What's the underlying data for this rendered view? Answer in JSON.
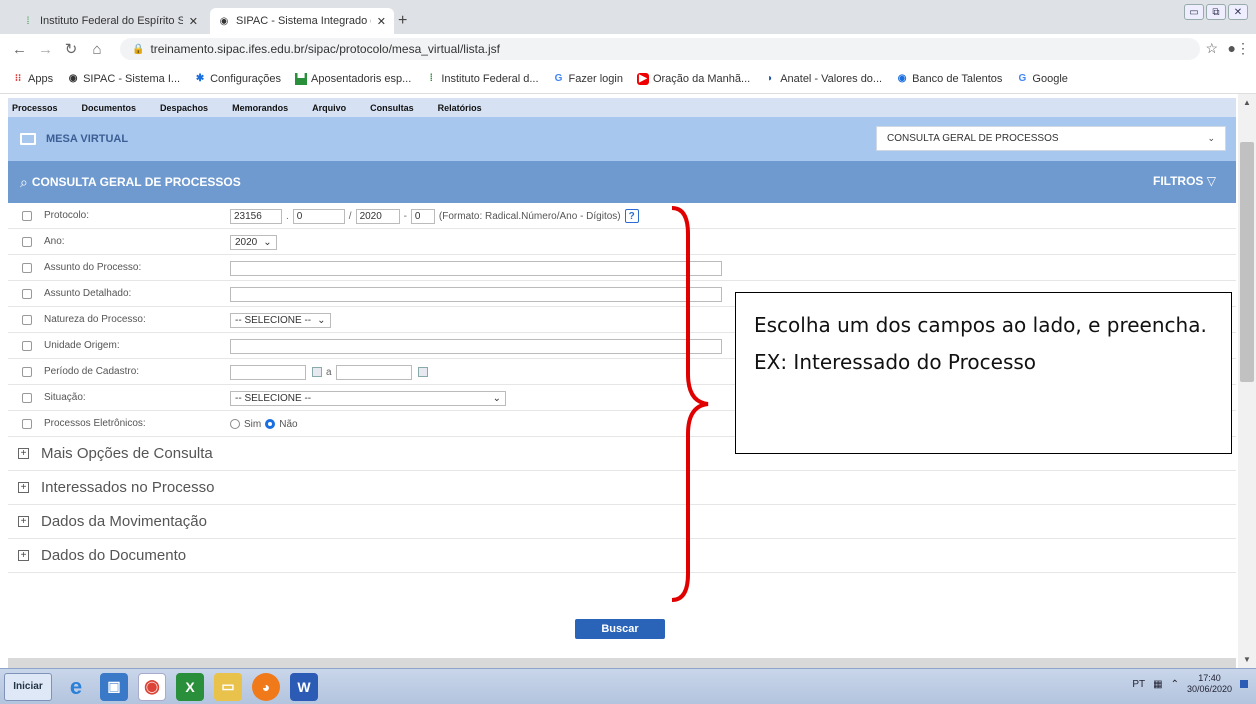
{
  "browser": {
    "tabs": [
      {
        "title": "Instituto Federal do Espírito Sant",
        "active": false,
        "icon": "ifes-icon"
      },
      {
        "title": "SIPAC - Sistema Integrado de P",
        "active": true,
        "icon": "globe-icon"
      }
    ],
    "url": "treinamento.sipac.ifes.edu.br/sipac/protocolo/mesa_virtual/lista.jsf",
    "bookmarks": [
      {
        "label": "Apps",
        "icon": "apps-grid-icon"
      },
      {
        "label": "SIPAC - Sistema I...",
        "icon": "globe-icon"
      },
      {
        "label": "Configurações",
        "icon": "gear-icon"
      },
      {
        "label": "Aposentadoris esp...",
        "icon": "bookmark-icon"
      },
      {
        "label": "Instituto Federal d...",
        "icon": "ifes-icon"
      },
      {
        "label": "Fazer login",
        "icon": "google-icon"
      },
      {
        "label": "Oração da Manhã...",
        "icon": "youtube-icon"
      },
      {
        "label": "Anatel - Valores do...",
        "icon": "anatel-icon"
      },
      {
        "label": "Banco de Talentos",
        "icon": "circle-icon"
      },
      {
        "label": "Google",
        "icon": "google-icon"
      }
    ]
  },
  "menu": [
    "Processos",
    "Documentos",
    "Despachos",
    "Memorandos",
    "Arquivo",
    "Consultas",
    "Relatórios"
  ],
  "mesa": {
    "title": "MESA VIRTUAL",
    "select_value": "CONSULTA GERAL DE PROCESSOS"
  },
  "consulta": {
    "title": "CONSULTA GERAL DE PROCESSOS",
    "filtros": "FILTROS"
  },
  "form": {
    "protocolo": {
      "label": "Protocolo:",
      "radical": "23156",
      "numero": "0",
      "ano": "2020",
      "digitos": "0",
      "formato": "(Formato: Radical.Número/Ano - Dígitos)"
    },
    "ano": {
      "label": "Ano:",
      "value": "2020"
    },
    "assunto": {
      "label": "Assunto do Processo:"
    },
    "assunto_detalhado": {
      "label": "Assunto Detalhado:"
    },
    "natureza": {
      "label": "Natureza do Processo:",
      "value": "-- SELECIONE --"
    },
    "unidade": {
      "label": "Unidade Origem:"
    },
    "periodo": {
      "label": "Período de Cadastro:",
      "a": "a"
    },
    "situacao": {
      "label": "Situação:",
      "value": "-- SELECIONE --"
    },
    "eletronicos": {
      "label": "Processos Eletrônicos:",
      "sim": "Sim",
      "nao": "Não",
      "selected": "Não"
    }
  },
  "sections": [
    "Mais Opções de Consulta",
    "Interessados no Processo",
    "Dados da Movimentação",
    "Dados do Documento"
  ],
  "buscar": "Buscar",
  "annotation": "Escolha um dos campos ao lado, e preencha. EX: Interessado do Processo",
  "taskbar": {
    "start": "Iniciar",
    "lang": "PT",
    "time": "17:40",
    "date": "30/06/2020"
  }
}
